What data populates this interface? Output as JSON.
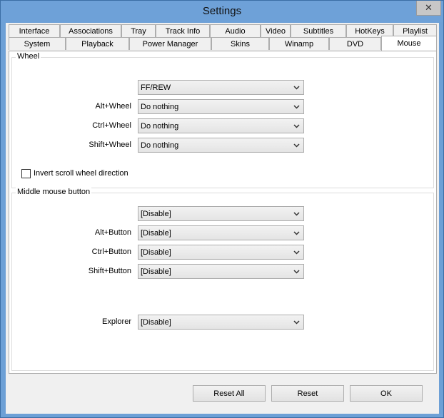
{
  "window": {
    "title": "Settings",
    "close_glyph": "✕"
  },
  "tabs": {
    "row1": [
      "Interface",
      "Associations",
      "Tray",
      "Track Info",
      "Audio",
      "Video",
      "Subtitles",
      "HotKeys",
      "Playlist"
    ],
    "row2": [
      "System",
      "Playback",
      "Power Manager",
      "Skins",
      "Winamp",
      "DVD",
      "Mouse"
    ],
    "active": "Mouse"
  },
  "wheel_group": {
    "title": "Wheel",
    "rows": [
      {
        "label": "",
        "value": "FF/REW"
      },
      {
        "label": "Alt+Wheel",
        "value": "Do nothing"
      },
      {
        "label": "Ctrl+Wheel",
        "value": "Do nothing"
      },
      {
        "label": "Shift+Wheel",
        "value": "Do nothing"
      }
    ],
    "invert_label": "Invert scroll wheel direction",
    "invert_checked": false
  },
  "middle_group": {
    "title": "Middle mouse button",
    "rows": [
      {
        "label": "",
        "value": "[Disable]"
      },
      {
        "label": "Alt+Button",
        "value": "[Disable]"
      },
      {
        "label": "Ctrl+Button",
        "value": "[Disable]"
      },
      {
        "label": "Shift+Button",
        "value": "[Disable]"
      }
    ],
    "explorer": {
      "label": "Explorer",
      "value": "[Disable]"
    }
  },
  "buttons": {
    "reset_all": "Reset All",
    "reset": "Reset",
    "ok": "OK"
  },
  "icons": {
    "combo_arrow": "chevron-down-icon",
    "close": "close-icon"
  }
}
